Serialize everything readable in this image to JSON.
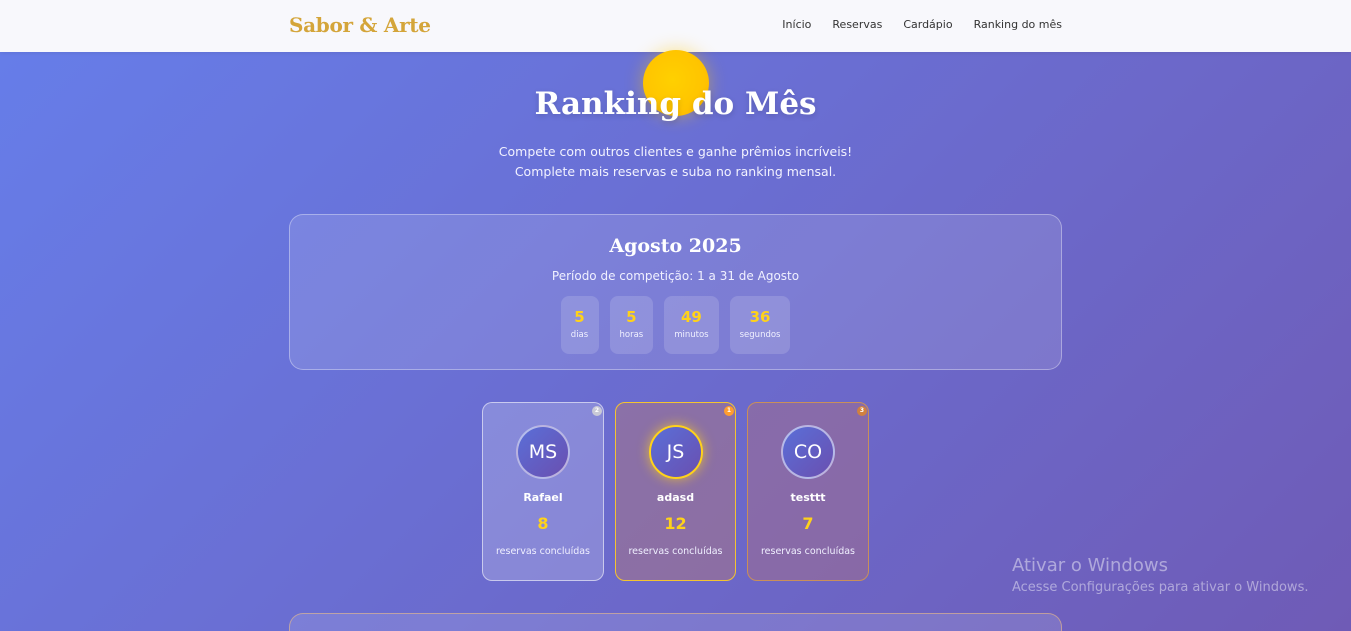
{
  "navbar": {
    "brand": "Sabor & Arte",
    "links": [
      "Início",
      "Reservas",
      "Cardápio",
      "Ranking do mês"
    ]
  },
  "hero": {
    "title": "Ranking do Mês",
    "subtitle": "Compete com outros clientes e ganhe prêmios incríveis! Complete mais reservas e suba no ranking mensal."
  },
  "period": {
    "title": "Agosto 2025",
    "description": "Período de competição: 1 a 31 de Agosto",
    "countdown": [
      {
        "value": "5",
        "label": "dias"
      },
      {
        "value": "5",
        "label": "horas"
      },
      {
        "value": "49",
        "label": "minutos"
      },
      {
        "value": "36",
        "label": "segundos"
      }
    ]
  },
  "podium": {
    "second": {
      "rank": "2",
      "initials": "MS",
      "name": "Rafael",
      "score": "8",
      "label": "reservas concluídas"
    },
    "first": {
      "rank": "1",
      "initials": "JS",
      "name": "adasd",
      "score": "12",
      "label": "reservas concluídas"
    },
    "third": {
      "rank": "3",
      "initials": "CO",
      "name": "testtt",
      "score": "7",
      "label": "reservas concluídas"
    }
  },
  "watermark": {
    "title": "Ativar o Windows",
    "subtitle": "Acesse Configurações para ativar o Windows."
  },
  "colors": {
    "accent": "#ffd21a",
    "brand": "#d4a53a",
    "gradient_start": "#667eea",
    "gradient_end": "#6f5bb6"
  }
}
